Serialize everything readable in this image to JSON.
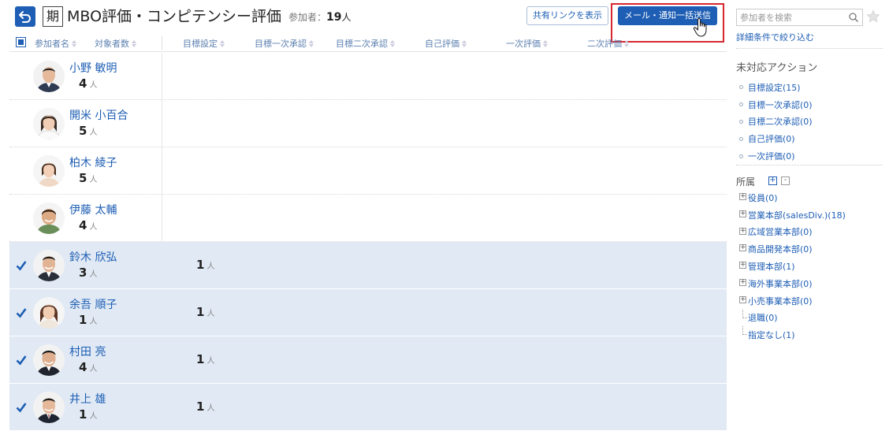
{
  "header": {
    "period_label": "期",
    "title": "MBO評価・コンピテンシー評価",
    "participants_label": "参加者：",
    "participants_count": "19",
    "participants_unit": "人",
    "share_link_label": "共有リンクを表示",
    "send_button_label": "メール・通知一括送信"
  },
  "table": {
    "columns": [
      "参加者名",
      "対象者数",
      "目標設定",
      "目標一次承認",
      "目標二次承認",
      "自己評価",
      "一次評価",
      "二次評価"
    ],
    "unit": "人",
    "rows": [
      {
        "name": "小野 敏明",
        "count": "4",
        "selected": false,
        "goal_count": ""
      },
      {
        "name": "開米 小百合",
        "count": "5",
        "selected": false,
        "goal_count": ""
      },
      {
        "name": "柏木 綾子",
        "count": "5",
        "selected": false,
        "goal_count": ""
      },
      {
        "name": "伊藤 太輔",
        "count": "4",
        "selected": false,
        "goal_count": ""
      },
      {
        "name": "鈴木 欣弘",
        "count": "3",
        "selected": true,
        "goal_count": "1"
      },
      {
        "name": "余吾 順子",
        "count": "1",
        "selected": true,
        "goal_count": "1"
      },
      {
        "name": "村田 亮",
        "count": "4",
        "selected": true,
        "goal_count": "1"
      },
      {
        "name": "井上 雄",
        "count": "1",
        "selected": true,
        "goal_count": "1"
      }
    ]
  },
  "sidebar": {
    "search_placeholder": "参加者を検索",
    "refine_label": "詳細条件で絞り込む",
    "actions_heading": "未対応アクション",
    "actions": [
      "目標設定(15)",
      "目標一次承認(0)",
      "目標二次承認(0)",
      "自己評価(0)",
      "一次評価(0)"
    ],
    "org_heading": "所属",
    "orgs": [
      {
        "label": "役員(0)",
        "expandable": true
      },
      {
        "label": "営業本部(salesDiv.)(18)",
        "expandable": true
      },
      {
        "label": "広域営業本部(0)",
        "expandable": true
      },
      {
        "label": "商品開発本部(0)",
        "expandable": true
      },
      {
        "label": "管理本部(1)",
        "expandable": true
      },
      {
        "label": "海外事業本部(0)",
        "expandable": true
      },
      {
        "label": "小売事業本部(0)",
        "expandable": true
      },
      {
        "label": "退職(0)",
        "expandable": false
      },
      {
        "label": "指定なし(1)",
        "expandable": false
      }
    ]
  },
  "colors": {
    "primary": "#1e5eb4",
    "selected_row": "#e0e9f4",
    "highlight_border": "#d7262e"
  },
  "icons": [
    "back-arrow-icon",
    "search-icon",
    "star-icon",
    "hand-cursor-icon",
    "check-icon",
    "sort-icon",
    "plus-icon",
    "minus-icon"
  ]
}
